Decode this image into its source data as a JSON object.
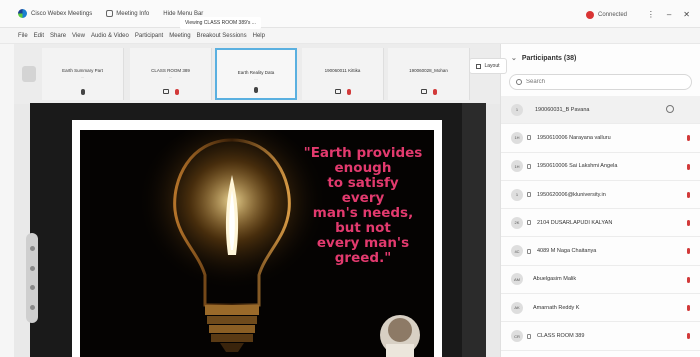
{
  "titlebar": {
    "app_name": "Cisco Webex Meetings",
    "meeting_info": "Meeting Info",
    "hide_menu": "Hide Menu Bar",
    "status": "Connected",
    "status_color": "#d93434"
  },
  "menu": [
    "File",
    "Edit",
    "Share",
    "View",
    "Audio & Video",
    "Participant",
    "Meeting",
    "Breakout Sessions",
    "Help"
  ],
  "filmstrip": {
    "layout_label": "Layout",
    "tiles": [
      {
        "name": "Earth Summary Part",
        "sub": "…"
      },
      {
        "name": "CLASS ROOM 389",
        "sub": "…"
      },
      {
        "name": "Earth Reality Data",
        "sub": "…"
      },
      {
        "name": "190060011 Kittika",
        "sub": ""
      },
      {
        "name": "190060028_Mohan",
        "sub": ""
      }
    ]
  },
  "share": {
    "viewing_label": "Viewing CLASS ROOM 389's ...",
    "quote_lines": [
      "\"Earth provides",
      "enough",
      "to satisfy",
      "every",
      "man's needs,",
      "but not",
      "every man's",
      "greed.\""
    ],
    "quote_color": "#e23a6e"
  },
  "participants": {
    "title": "Participants (38)",
    "search_placeholder": "Search",
    "items": [
      {
        "initials": "1",
        "name": "190060031_B Pavana"
      },
      {
        "initials": "1H",
        "name": "1950610006 Narayana valluru"
      },
      {
        "initials": "1H",
        "name": "1950610006 Sai Lakshmi Angela"
      },
      {
        "initials": "1",
        "name": "1950620006@kluniversity.in"
      },
      {
        "initials": "2K",
        "name": "2104 DUSARLAPUDI KALYAN"
      },
      {
        "initials": "4C",
        "name": "4089 M Naga Chaitanya"
      },
      {
        "initials": "AM",
        "name": "Abuelgasim Malik"
      },
      {
        "initials": "AK",
        "name": "Amarnath Reddy K"
      },
      {
        "initials": "CR",
        "name": "CLASS ROOM 389"
      }
    ]
  }
}
